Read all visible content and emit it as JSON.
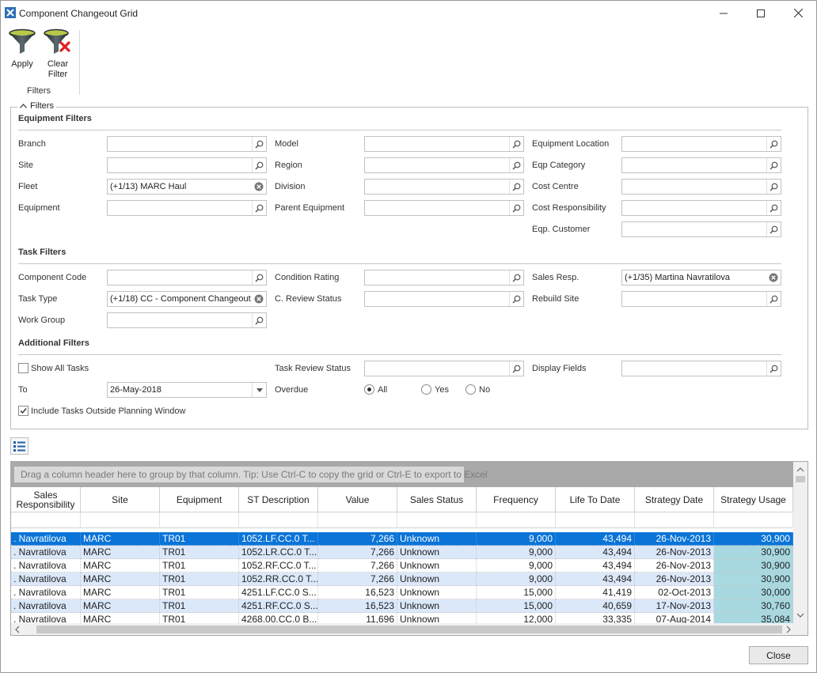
{
  "window": {
    "title": "Component Changeout Grid"
  },
  "ribbon": {
    "apply_label": "Apply",
    "clear_label_1": "Clear",
    "clear_label_2": "Filter",
    "group_label": "Filters"
  },
  "filters": {
    "legend": "Filters",
    "equipment_title": "Equipment Filters",
    "task_title": "Task Filters",
    "additional_title": "Additional Filters",
    "labels": {
      "branch": "Branch",
      "site": "Site",
      "fleet": "Fleet",
      "equipment": "Equipment",
      "model": "Model",
      "region": "Region",
      "division": "Division",
      "parent_equipment": "Parent Equipment",
      "equipment_location": "Equipment Location",
      "eqp_category": "Eqp Category",
      "cost_centre": "Cost Centre",
      "cost_responsibility": "Cost Responsibility",
      "eqp_customer": "Eqp. Customer",
      "component_code": "Component Code",
      "task_type": "Task Type",
      "work_group": "Work Group",
      "condition_rating": "Condition Rating",
      "c_review_status": "C. Review Status",
      "sales_resp": "Sales Resp.",
      "rebuild_site": "Rebuild Site",
      "show_all_tasks": "Show All Tasks",
      "to": "To",
      "include_tasks": "Include Tasks Outside Planning Window",
      "task_review_status": "Task Review Status",
      "overdue": "Overdue",
      "display_fields": "Display Fields",
      "all": "All",
      "yes": "Yes",
      "no": "No"
    },
    "values": {
      "fleet": "(+1/13) MARC Haul",
      "task_type": "(+1/18) CC - Component Changeout",
      "sales_resp": "(+1/35) Martina Navratilova",
      "to_date": "26-May-2018"
    },
    "show_all_tasks_checked": false,
    "include_tasks_checked": true,
    "overdue_selected": "All"
  },
  "grid": {
    "group_hint": "Drag a column header here to group by that column. Tip: Use Ctrl-C to copy the grid or Ctrl-E to export to Excel",
    "columns": {
      "sales_responsibility_1": "Sales",
      "sales_responsibility_2": "Responsibility",
      "site": "Site",
      "equipment": "Equipment",
      "st_description": "ST Description",
      "value": "Value",
      "sales_status": "Sales Status",
      "frequency": "Frequency",
      "life_to_date": "Life To Date",
      "strategy_date": "Strategy Date",
      "strategy_usage": "Strategy Usage"
    },
    "rows": [
      {
        "resp": ". Navratilova",
        "site": "MARC",
        "equip": "TR01",
        "desc": "1052.LF.CC.0  T...",
        "value": "7,266",
        "status": "Unknown",
        "freq": "9,000",
        "ltd": "43,494",
        "sdate": "26-Nov-2013",
        "usage": "30,900"
      },
      {
        "resp": ". Navratilova",
        "site": "MARC",
        "equip": "TR01",
        "desc": "1052.LR.CC.0  T...",
        "value": "7,266",
        "status": "Unknown",
        "freq": "9,000",
        "ltd": "43,494",
        "sdate": "26-Nov-2013",
        "usage": "30,900"
      },
      {
        "resp": ". Navratilova",
        "site": "MARC",
        "equip": "TR01",
        "desc": "1052.RF.CC.0  T...",
        "value": "7,266",
        "status": "Unknown",
        "freq": "9,000",
        "ltd": "43,494",
        "sdate": "26-Nov-2013",
        "usage": "30,900"
      },
      {
        "resp": ". Navratilova",
        "site": "MARC",
        "equip": "TR01",
        "desc": "1052.RR.CC.0  T...",
        "value": "7,266",
        "status": "Unknown",
        "freq": "9,000",
        "ltd": "43,494",
        "sdate": "26-Nov-2013",
        "usage": "30,900"
      },
      {
        "resp": ". Navratilova",
        "site": "MARC",
        "equip": "TR01",
        "desc": "4251.LF.CC.0  S...",
        "value": "16,523",
        "status": "Unknown",
        "freq": "15,000",
        "ltd": "41,419",
        "sdate": "02-Oct-2013",
        "usage": "30,000"
      },
      {
        "resp": ". Navratilova",
        "site": "MARC",
        "equip": "TR01",
        "desc": "4251.RF.CC.0  S...",
        "value": "16,523",
        "status": "Unknown",
        "freq": "15,000",
        "ltd": "40,659",
        "sdate": "17-Nov-2013",
        "usage": "30,760"
      },
      {
        "resp": ". Navratilova",
        "site": "MARC",
        "equip": "TR01",
        "desc": "4268.00.CC.0  B...",
        "value": "11,696",
        "status": "Unknown",
        "freq": "12,000",
        "ltd": "33,335",
        "sdate": "07-Aug-2014",
        "usage": "35,084"
      }
    ]
  },
  "footer": {
    "close_label": "Close"
  },
  "colors": {
    "selection": "#0a74d8",
    "alt_row": "#dbe8fa",
    "usage_col": "#a8d8e0"
  }
}
